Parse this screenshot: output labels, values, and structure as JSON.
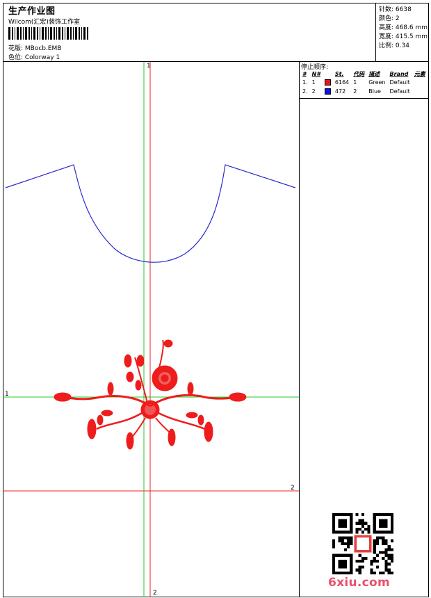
{
  "header": {
    "title": "生产作业图",
    "company": "Wilcom(汇宏)装饰工作室",
    "design": "花版:   MBocb.EMB",
    "colorway": "色位:   Colorway 1"
  },
  "stats": {
    "stitches": "针数: 6638",
    "colors": "颜色: 2",
    "height": "高度: 468.6 mm",
    "width": "宽度: 415.5 mm",
    "scale": "比例: 0.34"
  },
  "stop_sequence": {
    "title": "停止顺序:",
    "columns": [
      "#",
      "N#",
      "St.",
      "代码",
      "描述",
      "Brand",
      "元素"
    ],
    "rows": [
      {
        "num": "1.",
        "n": "1",
        "stitches": "6164",
        "code": "1",
        "desc": "Green",
        "brand": "Default",
        "color": "#e8141b"
      },
      {
        "num": "2.",
        "n": "2",
        "stitches": "472",
        "code": "2",
        "desc": "Blue",
        "brand": "Default",
        "color": "#1010e8"
      }
    ]
  },
  "axes": {
    "top_label": "1",
    "left_label": "1",
    "right_label": "2",
    "bottom_label": "2"
  },
  "colors": {
    "embroidery_red": "#ee1c1c",
    "outline_blue": "#2a2ad0",
    "guide_green": "#22cc22",
    "guide_red": "#ee2222"
  },
  "watermark": "6xiu.com"
}
